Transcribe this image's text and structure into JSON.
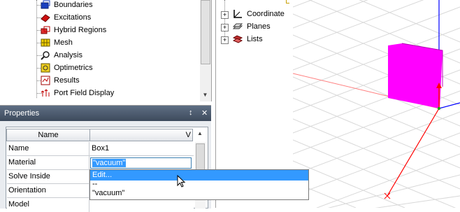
{
  "project_tree": {
    "items": [
      {
        "label": "Boundaries",
        "icon": "boundaries-icon"
      },
      {
        "label": "Excitations",
        "icon": "excitations-icon"
      },
      {
        "label": "Hybrid Regions",
        "icon": "hybrid-regions-icon"
      },
      {
        "label": "Mesh",
        "icon": "mesh-icon"
      },
      {
        "label": "Analysis",
        "icon": "analysis-icon"
      },
      {
        "label": "Optimetrics",
        "icon": "optimetrics-icon"
      },
      {
        "label": "Results",
        "icon": "results-icon"
      },
      {
        "label": "Port Field Display",
        "icon": "port-field-display-icon"
      }
    ]
  },
  "properties": {
    "title": "Properties",
    "pin_glyph": "↕",
    "close_glyph": "✕",
    "columns": {
      "name": "Name",
      "value": "V"
    },
    "rows": [
      {
        "key": "Name",
        "value": "Box1"
      },
      {
        "key": "Material",
        "value": "\"vacuum\""
      },
      {
        "key": "Solve Inside",
        "value": ""
      },
      {
        "key": "Orientation",
        "value": ""
      },
      {
        "key": "Model",
        "value": ""
      }
    ],
    "dropdown": {
      "options": [
        "Edit...",
        "--",
        "\"vacuum\""
      ]
    }
  },
  "model_tree": {
    "items": [
      {
        "label": "Coordinate",
        "icon": "coordinate-system-icon"
      },
      {
        "label": "Planes",
        "icon": "planes-icon"
      },
      {
        "label": "Lists",
        "icon": "lists-icon"
      }
    ]
  },
  "viewport": {
    "box_color": "#ff00ff",
    "axis_colors": {
      "x": "#ff0000",
      "y": "#00aa00",
      "z": "#0000ff"
    }
  }
}
